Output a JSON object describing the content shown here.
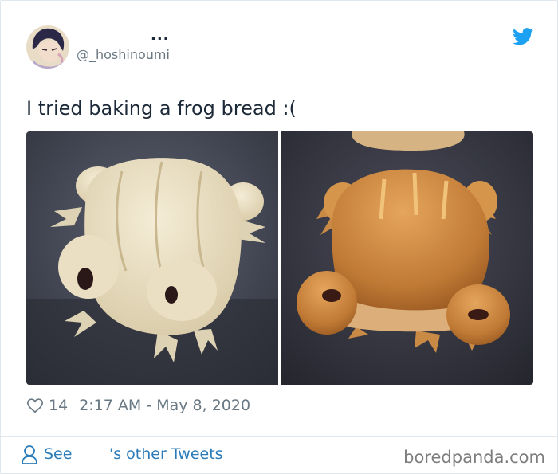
{
  "tweet": {
    "display_name": "...",
    "handle": "@_hoshinoumi",
    "text": "I tried baking a frog bread :(",
    "likes": "14",
    "timestamp": "2:17 AM - May 8, 2020"
  },
  "footer": {
    "see_label": "See",
    "other_tweets_label": "'s other Tweets"
  },
  "watermark": "boredpanda.com",
  "colors": {
    "twitter_blue": "#1da1f2",
    "link": "#2b7bb9",
    "muted": "#697882",
    "text": "#1c2938"
  },
  "icons": {
    "brand": "twitter-bird-icon",
    "like": "heart-icon",
    "profile": "person-icon"
  }
}
